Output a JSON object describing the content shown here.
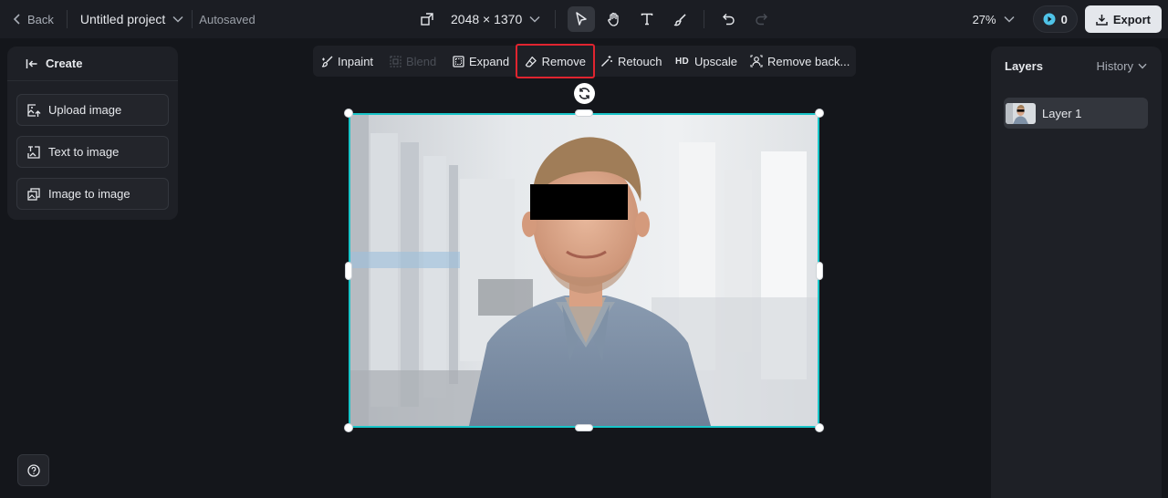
{
  "topbar": {
    "back_label": "Back",
    "project_name": "Untitled project",
    "autosaved": "Autosaved",
    "dimensions": "2048 × 1370",
    "zoom": "27%",
    "credits": "0",
    "export_label": "Export"
  },
  "tools": [
    {
      "icon": "select-arrow-icon",
      "active": true
    },
    {
      "icon": "hand-pan-icon",
      "active": false
    },
    {
      "icon": "text-tool-icon",
      "active": false
    },
    {
      "icon": "brush-icon",
      "active": false
    },
    {
      "icon": "undo-icon",
      "active": false
    },
    {
      "icon": "redo-icon",
      "active": false
    }
  ],
  "left_panel": {
    "title": "Create",
    "buttons": [
      "Upload image",
      "Text to image",
      "Image to image"
    ]
  },
  "edit_toolbar": {
    "items": [
      {
        "label": "Inpaint",
        "icon": "inpaint-icon",
        "disabled": false
      },
      {
        "label": "Blend",
        "icon": "blend-icon",
        "disabled": true
      },
      {
        "label": "Expand",
        "icon": "expand-icon",
        "disabled": false
      },
      {
        "label": "Remove",
        "icon": "eraser-icon",
        "disabled": false,
        "highlighted": true
      },
      {
        "label": "Retouch",
        "icon": "retouch-wand-icon",
        "disabled": false
      },
      {
        "label": "Upscale",
        "icon": "hd-icon",
        "icon_text": "HD",
        "disabled": false
      },
      {
        "label": "Remove back...",
        "icon": "remove-background-icon",
        "disabled": false
      }
    ]
  },
  "right_panel": {
    "title": "Layers",
    "history_label": "History",
    "layers": [
      {
        "name": "Layer 1"
      }
    ]
  },
  "colors": {
    "selection": "#19c4c8",
    "highlight": "#e0242f",
    "credits_accent": "#4fc3e8"
  }
}
